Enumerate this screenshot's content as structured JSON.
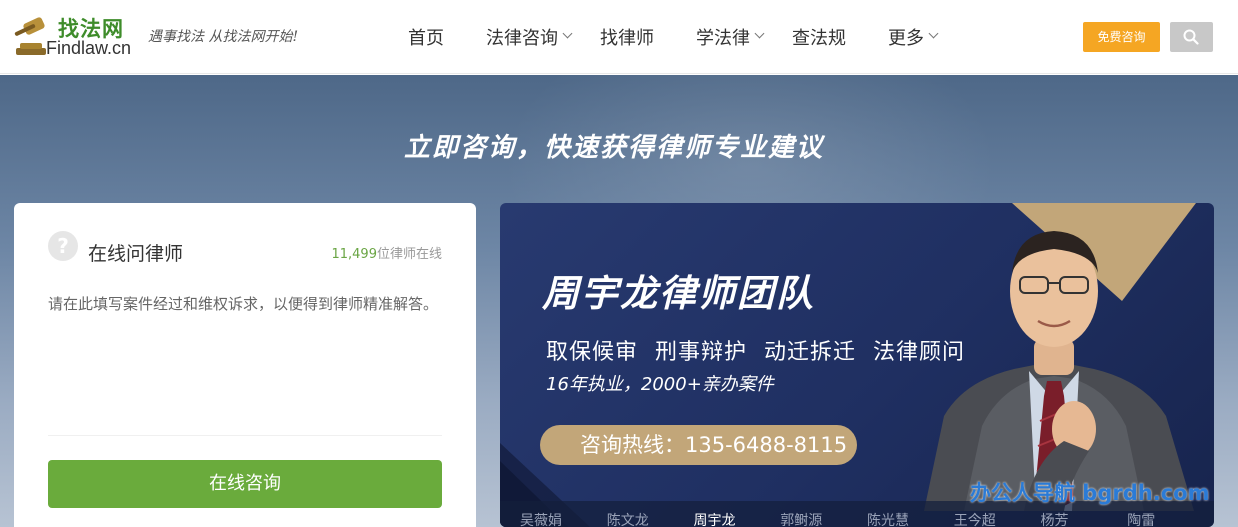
{
  "header": {
    "logo_cn": "找法网",
    "logo_en": "Findlaw.cn",
    "slogan": "遇事找法 从找法网开始!",
    "consult_button": "免费咨询"
  },
  "nav": [
    {
      "label": "首页",
      "has_dropdown": false
    },
    {
      "label": "法律咨询",
      "has_dropdown": true
    },
    {
      "label": "找律师",
      "has_dropdown": false
    },
    {
      "label": "学法律",
      "has_dropdown": true
    },
    {
      "label": "查法规",
      "has_dropdown": false
    },
    {
      "label": "更多",
      "has_dropdown": true
    }
  ],
  "hero": {
    "title": "立即咨询，快速获得律师专业建议"
  },
  "ask_card": {
    "title": "在线问律师",
    "online_count": "11,499",
    "online_suffix": "位律师在线",
    "placeholder": "请在此填写案件经过和维权诉求，以便得到律师精准解答。",
    "submit_label": "在线咨询"
  },
  "banner": {
    "team_name": "周宇龙律师团队",
    "services": [
      "取保候审",
      "刑事辩护",
      "动迁拆迁",
      "法律顾问"
    ],
    "experience": "16年执业，2000+亲办案件",
    "hotline": "咨询热线：135-6488-8115",
    "tabs": [
      "吴薇娟",
      "陈文龙",
      "周宇龙",
      "郭鲥源",
      "陈光慧",
      "王今超",
      "杨芳",
      "陶雷"
    ],
    "active_tab_index": 2
  },
  "watermark": "办公人导航 bgrdh.com",
  "colors": {
    "brand_green": "#6aab3c",
    "consult_orange": "#f5a623",
    "banner_navy": "#23356a",
    "hotline_gold": "#c2a679"
  }
}
